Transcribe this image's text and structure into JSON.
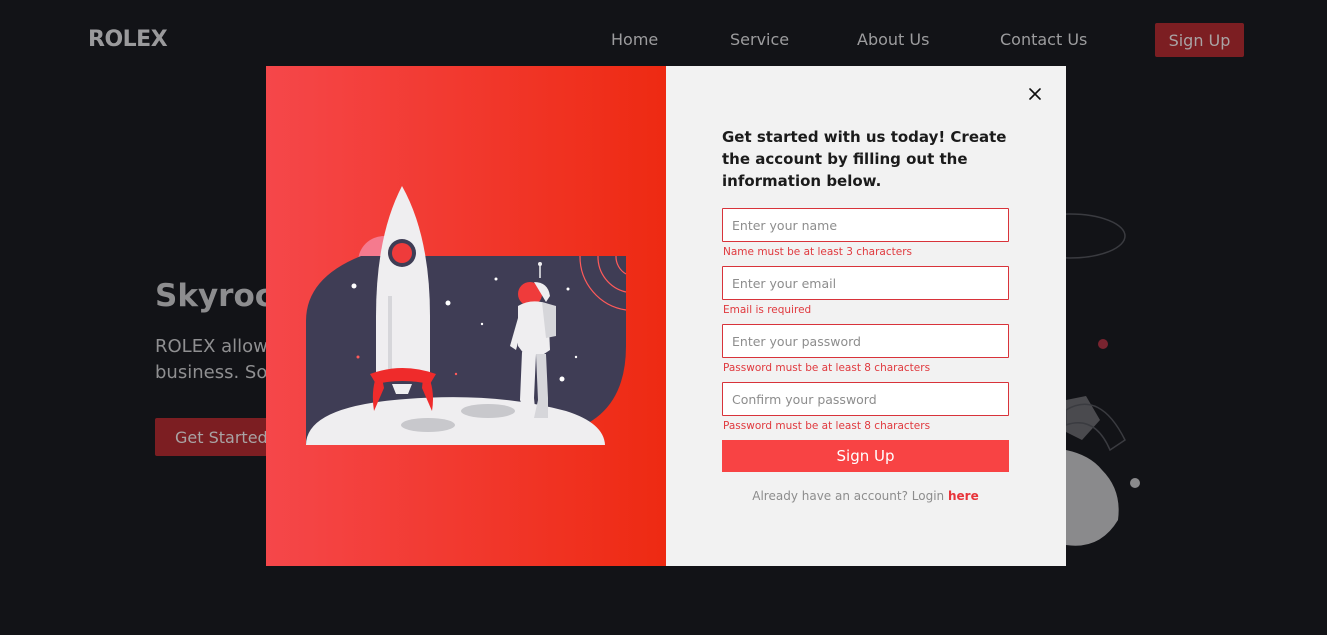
{
  "nav": {
    "logo": "ROLEX",
    "links": [
      "Home",
      "Service",
      "About Us",
      "Contact Us"
    ],
    "signup_label": "Sign Up"
  },
  "hero": {
    "title_visible": "Skyrock",
    "line1_visible": "ROLEX allow",
    "line2_visible": "business. So",
    "cta_label": "Get Started"
  },
  "modal": {
    "heading": "Get started with us today! Create the account by filling out the information below.",
    "fields": [
      {
        "placeholder": "Enter your name",
        "value": "",
        "error": "Name must be at least 3 characters"
      },
      {
        "placeholder": "Enter your email",
        "value": "",
        "error": "Email is required"
      },
      {
        "placeholder": "Enter your password",
        "value": "",
        "error": "Password must be at least 8 characters"
      },
      {
        "placeholder": "Confirm your password",
        "value": "",
        "error": "Password must be at least 8 characters"
      }
    ],
    "submit_label": "Sign Up",
    "login_prompt": "Already have an account? Login",
    "login_link": "here",
    "close_icon": "close-icon"
  },
  "colors": {
    "page_bg": "#121317",
    "accent": "#f84344",
    "error": "#e0393e",
    "panel_gradient_start": "#f5474a",
    "panel_gradient_end": "#ee2a12",
    "form_bg": "#f2f2f2"
  }
}
